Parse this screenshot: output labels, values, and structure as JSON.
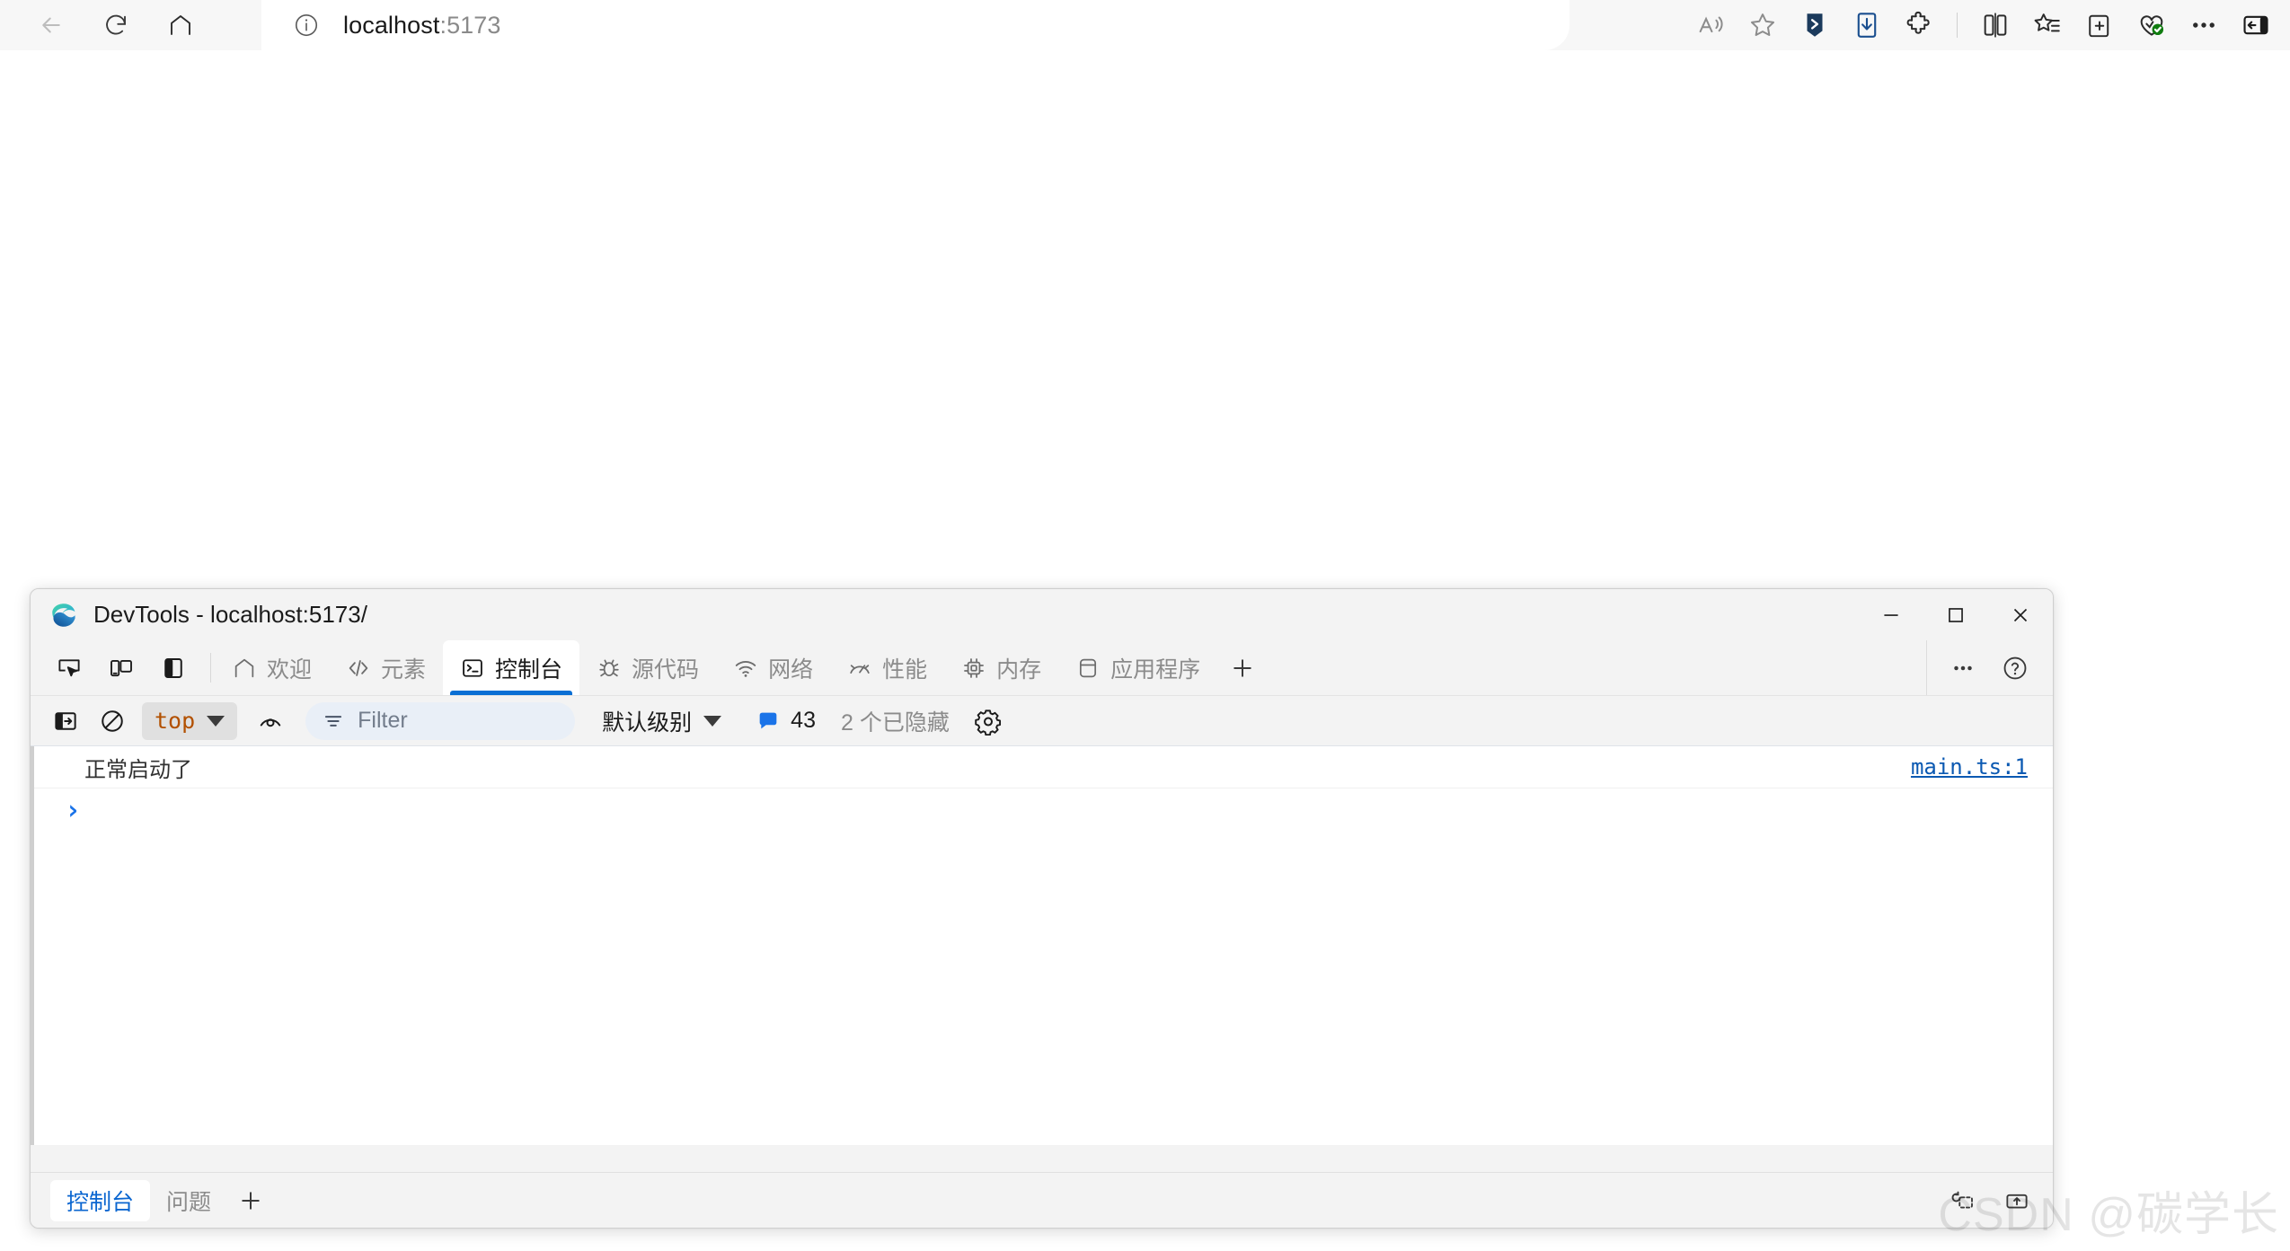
{
  "browser": {
    "nav": [
      {
        "name": "back-button",
        "icon": "arrow-left-icon"
      },
      {
        "name": "refresh-button",
        "icon": "refresh-icon"
      },
      {
        "name": "home-button",
        "icon": "home-icon"
      }
    ],
    "url": {
      "host": "localhost",
      "port": ":5173",
      "full": "localhost:5173",
      "info_icon": "info-circle-icon"
    },
    "toolbar_right": [
      {
        "name": "read-aloud-button",
        "icon": "read-aloud-icon"
      },
      {
        "name": "add-favorite-button",
        "icon": "star-icon"
      },
      {
        "name": "copilot-button",
        "icon": "copilot-icon"
      },
      {
        "name": "downloads-button",
        "icon": "download-icon"
      },
      {
        "name": "extensions-button",
        "icon": "puzzle-icon"
      },
      {
        "name": "split-screen-button",
        "icon": "split-screen-icon"
      },
      {
        "name": "favorites-button",
        "icon": "favorites-list-icon"
      },
      {
        "name": "collections-button",
        "icon": "collections-add-icon"
      },
      {
        "name": "browser-essentials-button",
        "icon": "heart-check-icon"
      },
      {
        "name": "settings-more-button",
        "icon": "ellipsis-icon"
      },
      {
        "name": "sidebar-toggle-button",
        "icon": "sidebar-right-icon"
      }
    ]
  },
  "devtools": {
    "title": "DevTools - localhost:5173/",
    "logo": "edge-logo-icon",
    "window_controls": [
      {
        "name": "minimize-button",
        "icon": "minimize-icon",
        "glyph": "—"
      },
      {
        "name": "maximize-button",
        "icon": "maximize-icon",
        "glyph": "□"
      },
      {
        "name": "close-button",
        "icon": "close-icon",
        "glyph": "✕"
      }
    ],
    "quick_icons": [
      {
        "name": "inspect-element-button",
        "icon": "inspect-cursor-icon"
      },
      {
        "name": "device-toolbar-button",
        "icon": "device-emulation-icon"
      },
      {
        "name": "dock-side-button",
        "icon": "dock-panel-icon"
      }
    ],
    "tabs": [
      {
        "label": "欢迎",
        "icon": "home-icon",
        "active": false
      },
      {
        "label": "元素",
        "icon": "code-brackets-icon",
        "active": false
      },
      {
        "label": "控制台",
        "icon": "console-terminal-icon",
        "active": true
      },
      {
        "label": "源代码",
        "icon": "bug-icon",
        "active": false
      },
      {
        "label": "网络",
        "icon": "wifi-icon",
        "active": false
      },
      {
        "label": "性能",
        "icon": "gauge-icon",
        "active": false
      },
      {
        "label": "内存",
        "icon": "chip-icon",
        "active": false
      },
      {
        "label": "应用程序",
        "icon": "application-box-icon",
        "active": false
      }
    ],
    "tab_add": {
      "name": "more-tools-button",
      "icon": "plus-icon",
      "glyph": "+"
    },
    "tabstrip_right": [
      {
        "name": "devtools-more-options-button",
        "icon": "ellipsis-icon"
      },
      {
        "name": "devtools-help-button",
        "icon": "help-circle-icon"
      }
    ],
    "console_toolbar": {
      "sidebar_toggle": {
        "name": "console-sidebar-toggle",
        "icon": "show-console-sidebar-icon"
      },
      "clear_console": {
        "name": "clear-console-button",
        "icon": "clear-no-entry-icon"
      },
      "context": {
        "value": "top",
        "name": "javascript-context-select"
      },
      "live_expression": {
        "name": "create-live-expression-button",
        "icon": "eye-icon"
      },
      "filter_placeholder": "Filter",
      "filter_icon": "filter-lines-icon",
      "level": {
        "value": "默认级别",
        "name": "log-level-select"
      },
      "message_count": "43",
      "message_icon": "speech-bubble-icon",
      "hidden_note": "2 个已隐藏",
      "settings": {
        "name": "console-settings-button",
        "icon": "gear-icon"
      }
    },
    "console_messages": [
      {
        "text": "正常启动了",
        "source": "main.ts:1"
      }
    ],
    "prompt_caret": "›",
    "statusbar": {
      "tabs": [
        {
          "label": "控制台",
          "active": true
        },
        {
          "label": "问题",
          "active": false
        }
      ],
      "add": {
        "name": "drawer-more-tools-button",
        "glyph": "+"
      },
      "right_icons": [
        {
          "name": "issues-refresh-icon",
          "icon": "refresh-box-icon"
        },
        {
          "name": "dock-undock-icon",
          "icon": "undock-icon"
        }
      ]
    }
  },
  "watermark": "CSDN @碳学长",
  "colors": {
    "accent": "#0a6fd4",
    "link": "#0b59b2",
    "chrome_bg": "#f7f7f7",
    "devtools_bg": "#f3f3f3"
  }
}
